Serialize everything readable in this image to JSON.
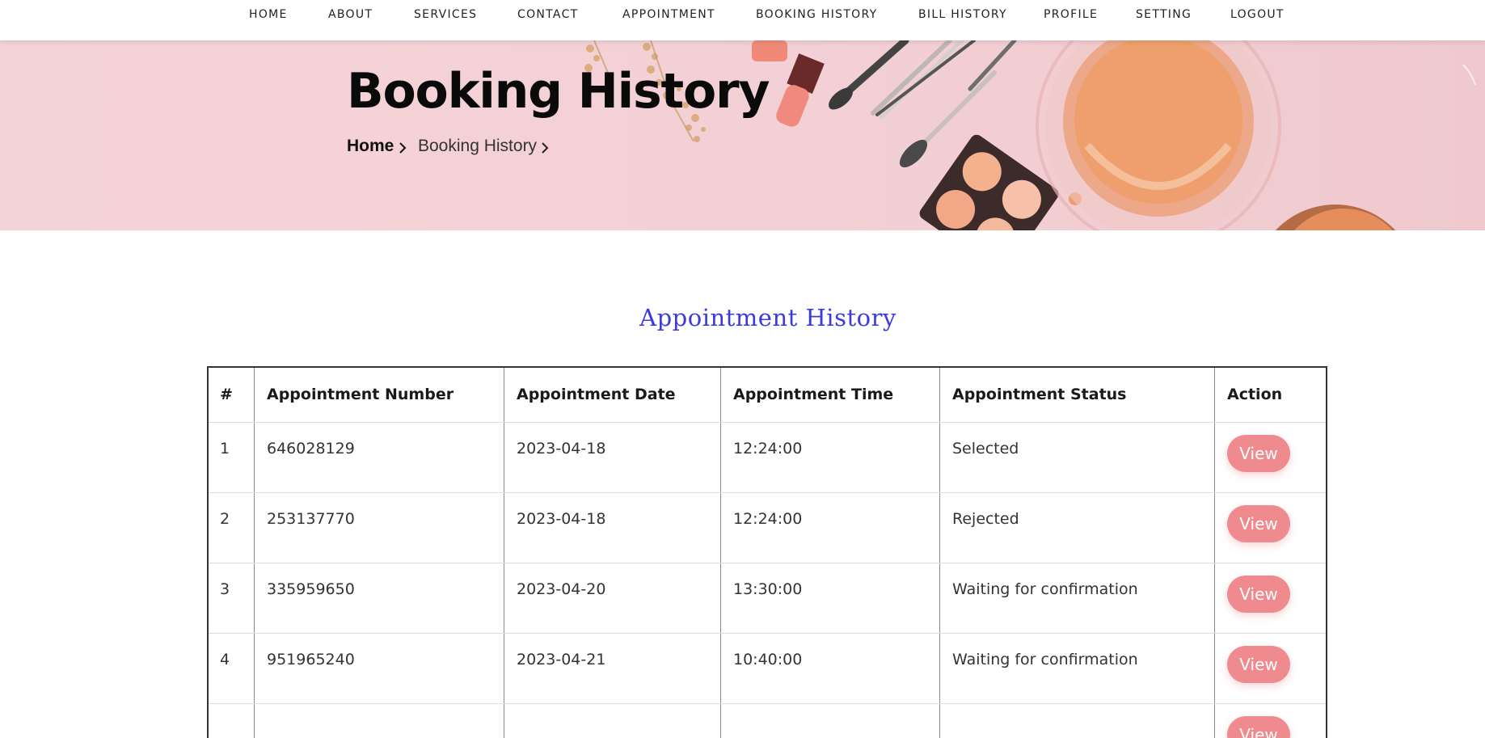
{
  "nav": {
    "items": [
      {
        "label": "HOME"
      },
      {
        "label": "ABOUT"
      },
      {
        "label": "SERVICES"
      },
      {
        "label": "CONTACT"
      },
      {
        "label": "APPOINTMENT"
      },
      {
        "label": "BOOKING HISTORY"
      },
      {
        "label": "BILL HISTORY"
      },
      {
        "label": "PROFILE"
      },
      {
        "label": "SETTING"
      },
      {
        "label": "LOGOUT"
      }
    ]
  },
  "hero": {
    "title": "Booking History",
    "breadcrumb": {
      "home": "Home",
      "current": "Booking History"
    }
  },
  "section": {
    "title": "Appointment History"
  },
  "table": {
    "headers": {
      "index": "#",
      "number": "Appointment Number",
      "date": "Appointment Date",
      "time": "Appointment Time",
      "status": "Appointment Status",
      "action": "Action"
    },
    "rows": [
      {
        "index": "1",
        "number": "646028129",
        "date": "2023-04-18",
        "time": "12:24:00",
        "status": "Selected",
        "action": "View"
      },
      {
        "index": "2",
        "number": "253137770",
        "date": "2023-04-18",
        "time": "12:24:00",
        "status": "Rejected",
        "action": "View"
      },
      {
        "index": "3",
        "number": "335959650",
        "date": "2023-04-20",
        "time": "13:30:00",
        "status": "Waiting for confirmation",
        "action": "View"
      },
      {
        "index": "4",
        "number": "951965240",
        "date": "2023-04-21",
        "time": "10:40:00",
        "status": "Waiting for confirmation",
        "action": "View"
      },
      {
        "index": "",
        "number": "",
        "date": "",
        "time": "",
        "status": "",
        "action": "View"
      }
    ]
  },
  "colors": {
    "hero_bg": "#f4d3d8",
    "accent_button": "#ef8b8f",
    "section_title": "#3a3ae0"
  }
}
